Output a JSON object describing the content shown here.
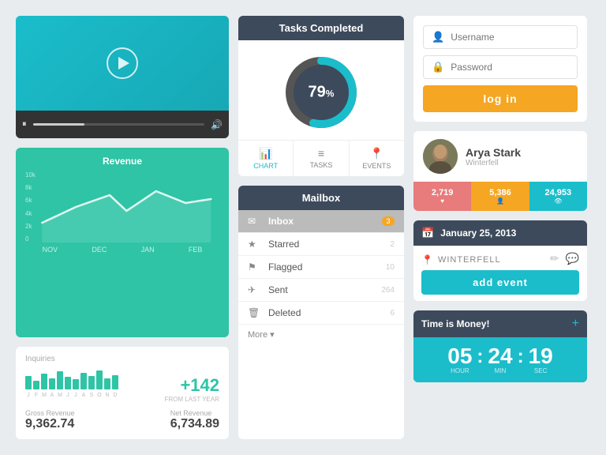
{
  "video": {
    "play_icon": "▶",
    "pause_icon": "⏸",
    "volume_icon": "🔊"
  },
  "revenue": {
    "title": "Revenue",
    "y_labels": [
      "10k",
      "8k",
      "6k",
      "4k",
      "2k",
      "0"
    ],
    "x_labels": [
      "NOV",
      "DEC",
      "JAN",
      "FEB"
    ],
    "line_color": "#ffffff"
  },
  "inquiries": {
    "label": "Inquiries",
    "spark_labels": [
      "J",
      "F",
      "M",
      "A",
      "M",
      "J",
      "J",
      "A",
      "S",
      "O",
      "N",
      "D"
    ],
    "spark_heights": [
      60,
      40,
      70,
      50,
      80,
      55,
      45,
      75,
      60,
      85,
      50,
      65
    ],
    "plus_value": "+142",
    "from_last_year": "FROM LAST YEAR",
    "gross_label": "Gross Revenue",
    "gross_value": "9,362.74",
    "net_label": "Net Revenue",
    "net_value": "6,734.89"
  },
  "tasks": {
    "header": "Tasks Completed",
    "percent": "79",
    "percent_sup": "%",
    "tabs": [
      {
        "label": "CHART",
        "icon": "📊",
        "active": true
      },
      {
        "label": "TASKS",
        "icon": "≡"
      },
      {
        "label": "EVENTS",
        "icon": "📍"
      }
    ]
  },
  "mailbox": {
    "header": "Mailbox",
    "items": [
      {
        "icon": "✉",
        "label": "Inbox",
        "badge": "3",
        "type": "badge",
        "active": true
      },
      {
        "icon": "★",
        "label": "Starred",
        "count": "2"
      },
      {
        "icon": "⚑",
        "label": "Flagged",
        "count": "10"
      },
      {
        "icon": "✈",
        "label": "Sent",
        "count": "264"
      },
      {
        "icon": "🗑",
        "label": "Deleted",
        "count": "6"
      }
    ],
    "more_label": "More ▾"
  },
  "login": {
    "username_placeholder": "Username",
    "password_placeholder": "Password",
    "button_label": "log in"
  },
  "profile": {
    "name": "Arya Stark",
    "location": "Winterfell",
    "stats": [
      {
        "value": "2,719",
        "label": "♥"
      },
      {
        "value": "5,386",
        "label": "👤"
      },
      {
        "value": "24,953",
        "label": "👁"
      }
    ]
  },
  "calendar": {
    "date": "January 25, 2013",
    "location": "WINTERFELL",
    "add_event_label": "add event"
  },
  "timer": {
    "title": "Time is Money!",
    "hours": "05",
    "minutes": "24",
    "seconds": "19",
    "hour_label": "HOUR",
    "min_label": "MIN",
    "sec_label": "SEC"
  }
}
